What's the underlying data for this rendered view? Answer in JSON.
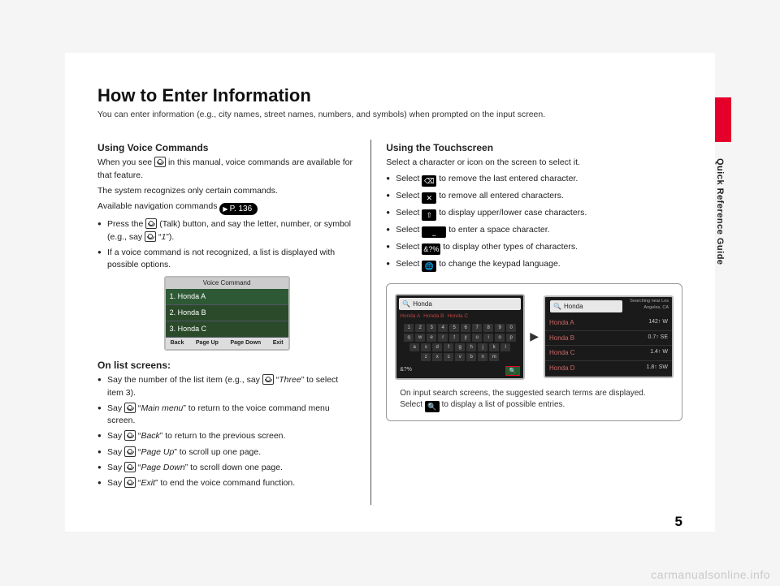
{
  "sideLabel": "Quick Reference Guide",
  "title": "How to Enter Information",
  "intro": "You can enter information (e.g., city names, street names, numbers, and symbols) when prompted on the input screen.",
  "left": {
    "sub1": "Using Voice Commands",
    "p1a": "When you see ",
    "p1b": " in this manual, voice commands are available for that feature.",
    "p2": "The system recognizes only certain commands.",
    "p3": "Available navigation commands ",
    "pageRef": "P. 136",
    "b1a": "Press the ",
    "b1b": " (Talk) button, and say the letter, number, or symbol (e.g., say ",
    "b1c": " “",
    "b1d": "1",
    "b1e": "”).",
    "b2": "If a voice command is not recognized, a list is displayed with possible options.",
    "vcTitle": "Voice Command",
    "vcItems": [
      "1. Honda A",
      "2. Honda B",
      "3. Honda C"
    ],
    "vcFoot": [
      "Back",
      "Page Up",
      "Page Down",
      "Exit"
    ],
    "sub2": "On list screens:",
    "l1a": "Say the number of the list item (e.g., say ",
    "l1b": " “",
    "l1c": "Three",
    "l1d": "” to select item 3).",
    "l2a": "Say ",
    "l2b": " “",
    "l2c": "Main menu",
    "l2d": "” to return to the voice command menu screen.",
    "l3a": "Say ",
    "l3c": "Back",
    "l3d": "” to return to the previous screen.",
    "l4c": "Page Up",
    "l4d": "” to scroll up one page.",
    "l5c": "Page Down",
    "l5d": "” to scroll down one page.",
    "l6c": "Exit",
    "l6d": "” to end the voice command function."
  },
  "right": {
    "sub1": "Using the Touchscreen",
    "p1": "Select a character or icon on the screen to select it.",
    "b1": " to remove the last entered character.",
    "b2": " to remove all entered characters.",
    "b3": " to display upper/lower case characters.",
    "b4": " to enter a space character.",
    "b5": " to display other types of characters.",
    "b6": " to change the keypad language.",
    "sel": "Select ",
    "kbd": {
      "search": "Honda",
      "tabs": [
        "Honda A",
        "Honda B",
        "Honda C"
      ],
      "row1": [
        "1",
        "2",
        "3",
        "4",
        "5",
        "6",
        "7",
        "8",
        "9",
        "0"
      ],
      "row2": [
        "q",
        "w",
        "e",
        "r",
        "t",
        "y",
        "u",
        "i",
        "o",
        "p"
      ],
      "row3": [
        "a",
        "s",
        "d",
        "f",
        "g",
        "h",
        "j",
        "k",
        "l"
      ],
      "row4": [
        "z",
        "x",
        "c",
        "v",
        "b",
        "n",
        "m"
      ],
      "botLeft": "&?%"
    },
    "list": {
      "search": "Honda",
      "topRight": "Searching near Los Angeles, CA",
      "rows": [
        {
          "n": "Honda A",
          "d": "142↑ W"
        },
        {
          "n": "Honda B",
          "d": "0.7↑ SE"
        },
        {
          "n": "Honda C",
          "d": "1.4↑ W"
        },
        {
          "n": "Honda D",
          "d": "1.8↑ SW"
        }
      ]
    },
    "cap1": "On input search screens, the suggested search terms are displayed. Select ",
    "cap2": " to display a list of possible entries."
  },
  "pageNum": "5",
  "watermark": "carmanualsonline.info",
  "icons": {
    "del": "⌫",
    "delAll": "✕",
    "shift": "⇧",
    "space": "⎵",
    "sym": "&?%",
    "globe": "🌐",
    "search": "🔍"
  }
}
